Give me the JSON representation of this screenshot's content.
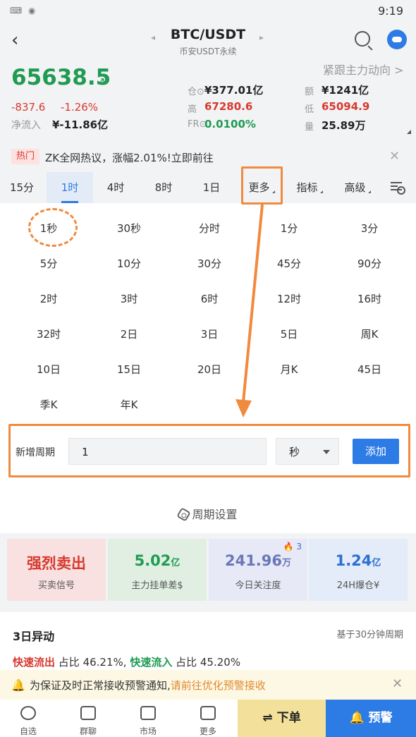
{
  "status": {
    "time": "9:19"
  },
  "header": {
    "pair": "BTC/USDT",
    "subtitle": "币安USDT永续"
  },
  "market": {
    "price": "65638.5",
    "follow": "紧跟主力动向 >",
    "change": "-837.6",
    "change_pct": "-1.26%",
    "net_flow_label": "净流入",
    "net_flow": "¥-11.86亿",
    "stats": [
      {
        "label": "仓⊙",
        "value": "¥377.01亿",
        "color": "#222"
      },
      {
        "label": "额",
        "value": "¥1241亿",
        "color": "#222"
      },
      {
        "label": "高",
        "value": "67280.6",
        "color": "#d8392f"
      },
      {
        "label": "低",
        "value": "65094.9",
        "color": "#d8392f"
      },
      {
        "label": "FR⊙",
        "value": "0.0100%",
        "color": "#1f9b52"
      },
      {
        "label": "量",
        "value": "25.89万",
        "color": "#222"
      }
    ]
  },
  "hot": {
    "badge": "热门",
    "text": "ZK全网热议，涨幅2.01%!立即前往"
  },
  "tabs": [
    "15分",
    "1时",
    "4时",
    "8时",
    "1日",
    "更多",
    "指标",
    "高级"
  ],
  "periods": [
    "1秒",
    "30秒",
    "分时",
    "1分",
    "3分",
    "5分",
    "10分",
    "30分",
    "45分",
    "90分",
    "2时",
    "3时",
    "6时",
    "12时",
    "16时",
    "32时",
    "2日",
    "3日",
    "5日",
    "周K",
    "10日",
    "15日",
    "20日",
    "月K",
    "45日",
    "季K",
    "年K"
  ],
  "add_period": {
    "label": "新增周期",
    "value": "1",
    "unit": "秒",
    "button": "添加"
  },
  "period_setting": "周期设置",
  "cards": [
    {
      "value": "强烈卖出",
      "unit": "",
      "label": "买卖信号",
      "bg": "#f8e1e0",
      "color": "#d8392f"
    },
    {
      "value": "5.02",
      "unit": "亿",
      "label": "主力挂单差$",
      "bg": "#e0efe2",
      "color": "#1f9b52"
    },
    {
      "value": "241.96",
      "unit": "万",
      "label": "今日关注度",
      "bg": "#e7e9f6",
      "color": "#6b78b8",
      "badge": "3"
    },
    {
      "value": "1.24",
      "unit": "亿",
      "label": "24H爆仓¥",
      "bg": "#e3ecf8",
      "color": "#2d6fd3"
    }
  ],
  "anomaly": {
    "title": "3日异动",
    "note": "基于30分钟周期",
    "out_label": "快速流出",
    "out_text": "占比 46.21%,",
    "in_label": "快速流入",
    "in_text": "占比 45.20%"
  },
  "notice": {
    "text": "为保证及时正常接收预警通知,",
    "link": "请前往优化预警接收"
  },
  "bottom": {
    "nav": [
      "自选",
      "群聊",
      "市场",
      "更多"
    ],
    "order": "⇌ 下单",
    "alert": "预警"
  },
  "colors": {
    "up": "#1f9b52",
    "down": "#d8392f",
    "accent": "#2d7be5",
    "highlight": "#f08a3e"
  }
}
